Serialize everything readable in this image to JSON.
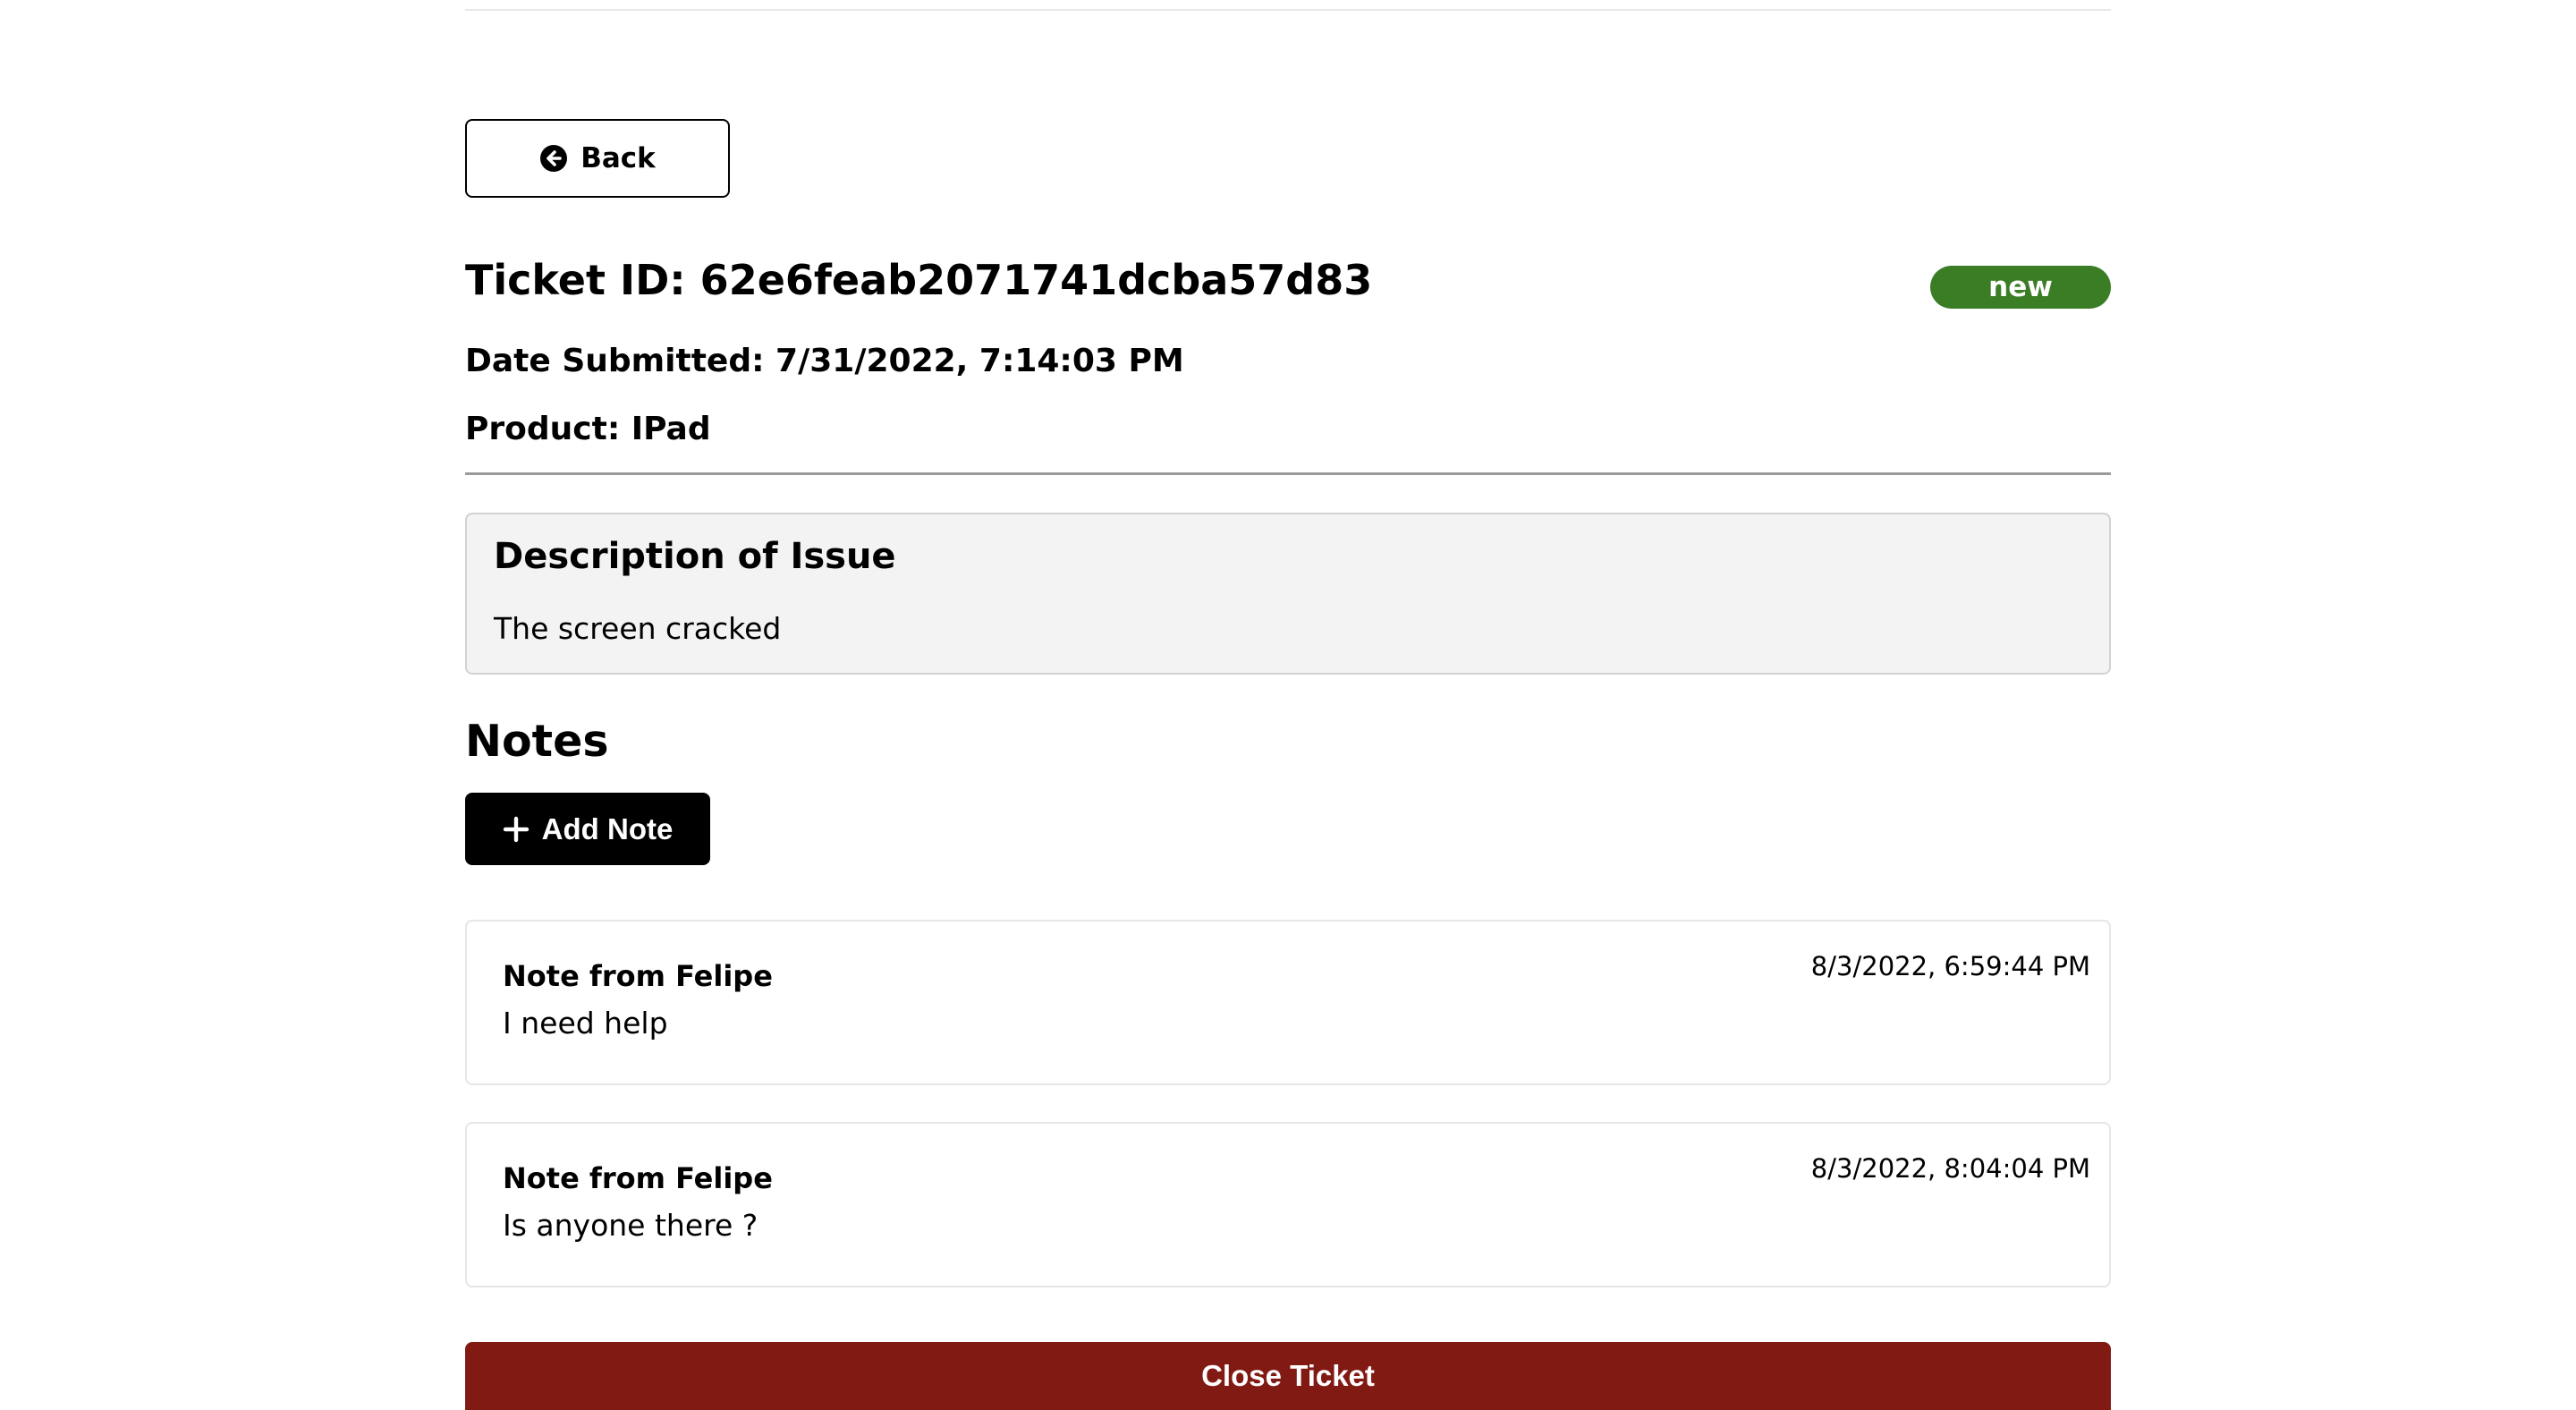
{
  "back_button": {
    "label": "Back",
    "icon": "arrow-circle-left-icon"
  },
  "ticket": {
    "id_text": "Ticket ID: 62e6feab2071741dcba57d83",
    "status": "new",
    "status_color": "#3a7d24",
    "date_text": "Date Submitted: 7/31/2022, 7:14:03 PM",
    "product_text": "Product: IPad"
  },
  "description": {
    "title": "Description of Issue",
    "text": "The screen cracked"
  },
  "notes": {
    "heading": "Notes",
    "add_label": "Add Note",
    "add_icon": "plus-icon",
    "items": [
      {
        "author": "Note from Felipe",
        "text": "I need help",
        "date": "8/3/2022, 6:59:44 PM"
      },
      {
        "author": "Note from Felipe",
        "text": "Is anyone there ?",
        "date": "8/3/2022, 8:04:04 PM"
      }
    ]
  },
  "close_button": {
    "label": "Close Ticket",
    "color": "#821a14"
  }
}
